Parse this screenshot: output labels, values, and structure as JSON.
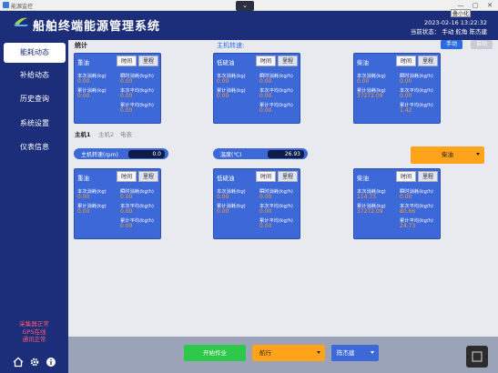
{
  "window": {
    "title": "能源监控",
    "min": "—",
    "max": "▢",
    "close": "✕",
    "collapse": "⌄"
  },
  "header": {
    "title": "船舶终端能源管理系统",
    "lang": "叠小化",
    "datetime": "2023-02-16 13:22:32",
    "status": "当前状态：  手动 舵角 陈杰建"
  },
  "sidebar": {
    "items": [
      {
        "label": "能耗动态",
        "active": true
      },
      {
        "label": "补给动态",
        "active": false
      },
      {
        "label": "历史查询",
        "active": false
      },
      {
        "label": "系统设置",
        "active": false
      },
      {
        "label": "仪表信息",
        "active": false
      }
    ],
    "status": [
      "采集器正常",
      "GPS在线",
      "通讯正常"
    ]
  },
  "labels": {
    "rt": "本次消耗(kg)",
    "rate": "瞬时消耗(kg/h)",
    "total": "累计消耗(kg)",
    "avg": "本次平均(kg/h)",
    "totavg": "累计平均(kg/h)",
    "tab1": "时间",
    "tab2": "里程"
  },
  "stats": {
    "title": "统计",
    "engine_label": "主机转速:",
    "btn_manual": "手动",
    "btn_other": "自动",
    "cards": [
      {
        "name": "重油",
        "rt": "0.00",
        "rate": "0.00",
        "total": "0.00",
        "avg": "0.00",
        "totavg": "0.00"
      },
      {
        "name": "低硫油",
        "rt": "0.00",
        "rate": "0.00",
        "total": "0.00",
        "avg": "0.00",
        "totavg": "0.00"
      },
      {
        "name": "柴油",
        "rt": "0.00",
        "rate": "0.00",
        "total": "37272.09",
        "avg": "0.00",
        "totavg": "1.42"
      }
    ]
  },
  "engine": {
    "tabs": [
      "主机1",
      "主机2",
      "电表"
    ],
    "rpm_label": "主机转速(rpm)",
    "rpm": "0.0",
    "temp_label": "温度(℃)",
    "temp": "26.93",
    "dropdown": "柴油",
    "cards": [
      {
        "name": "重油",
        "rt": "0.00",
        "rate": "0.00",
        "total": "0.00",
        "avg": "0.00",
        "totavg": "0.00"
      },
      {
        "name": "低硫油",
        "rt": "0.00",
        "rate": "0.00",
        "total": "0.00",
        "avg": "0.00",
        "totavg": "0.00"
      },
      {
        "name": "柴油",
        "rt": "114.73",
        "rate": "0.00",
        "total": "37272.09",
        "avg": "80.66",
        "totavg": "24.73"
      }
    ]
  },
  "bottom": {
    "start": "开始作业",
    "mode": "航行",
    "person": "陈杰建"
  },
  "colors": {
    "nav": "#1c2e7a",
    "card": "#3c68d8",
    "value": "#ff9a3a",
    "start": "#2ec84a",
    "dropdown": "#ffa31a",
    "status": "#ff5a6e"
  }
}
